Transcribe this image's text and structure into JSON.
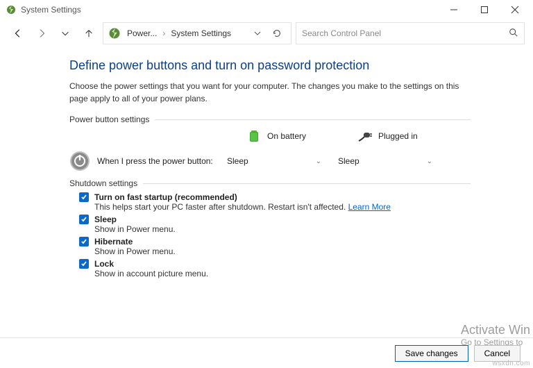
{
  "titlebar": {
    "title": "System Settings"
  },
  "breadcrumb": {
    "item1": "Power...",
    "item2": "System Settings"
  },
  "search": {
    "placeholder": "Search Control Panel"
  },
  "heading": "Define power buttons and turn on password protection",
  "description": "Choose the power settings that you want for your computer. The changes you make to the settings on this page apply to all of your power plans.",
  "sections": {
    "power_button": "Power button settings",
    "shutdown": "Shutdown settings"
  },
  "columns": {
    "battery": "On battery",
    "plugged": "Plugged in"
  },
  "row": {
    "label": "When I press the power button:",
    "battery_value": "Sleep",
    "plugged_value": "Sleep"
  },
  "shutdown": {
    "fast": {
      "label": "Turn on fast startup (recommended)",
      "sub": "This helps start your PC faster after shutdown. Restart isn't affected.",
      "learn": "Learn More"
    },
    "sleep": {
      "label": "Sleep",
      "sub": "Show in Power menu."
    },
    "hibernate": {
      "label": "Hibernate",
      "sub": "Show in Power menu."
    },
    "lock": {
      "label": "Lock",
      "sub": "Show in account picture menu."
    }
  },
  "buttons": {
    "save": "Save changes",
    "cancel": "Cancel"
  },
  "watermark": {
    "line1": "Activate Win",
    "line2": "Go to Settings to"
  },
  "attribution": "wsxdn.com"
}
